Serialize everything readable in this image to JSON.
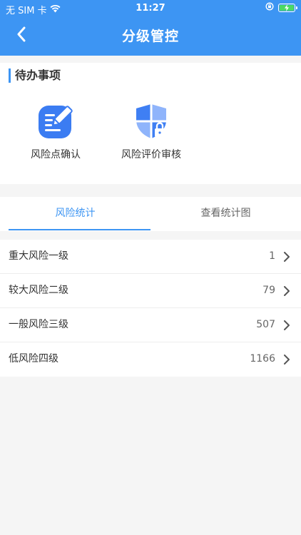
{
  "status": {
    "carrier": "无 SIM 卡",
    "time": "11:27"
  },
  "nav": {
    "title": "分级管控",
    "back_icon": "chevron-left-icon"
  },
  "todo": {
    "title": "待办事项",
    "items": [
      {
        "label": "风险点确认",
        "icon": "edit-note-icon"
      },
      {
        "label": "风险评价审核",
        "icon": "shield-lock-icon"
      }
    ]
  },
  "tabs": [
    {
      "label": "风险统计",
      "active": true
    },
    {
      "label": "查看统计图",
      "active": false
    }
  ],
  "risk_list": [
    {
      "label": "重大风险一级",
      "value": "1"
    },
    {
      "label": "较大风险二级",
      "value": "79"
    },
    {
      "label": "一般风险三级",
      "value": "507"
    },
    {
      "label": "低风险四级",
      "value": "1166"
    }
  ],
  "colors": {
    "accent": "#3d95f3",
    "icon_blue": "#3b7cf2",
    "shield_light": "#8fb4fb"
  }
}
